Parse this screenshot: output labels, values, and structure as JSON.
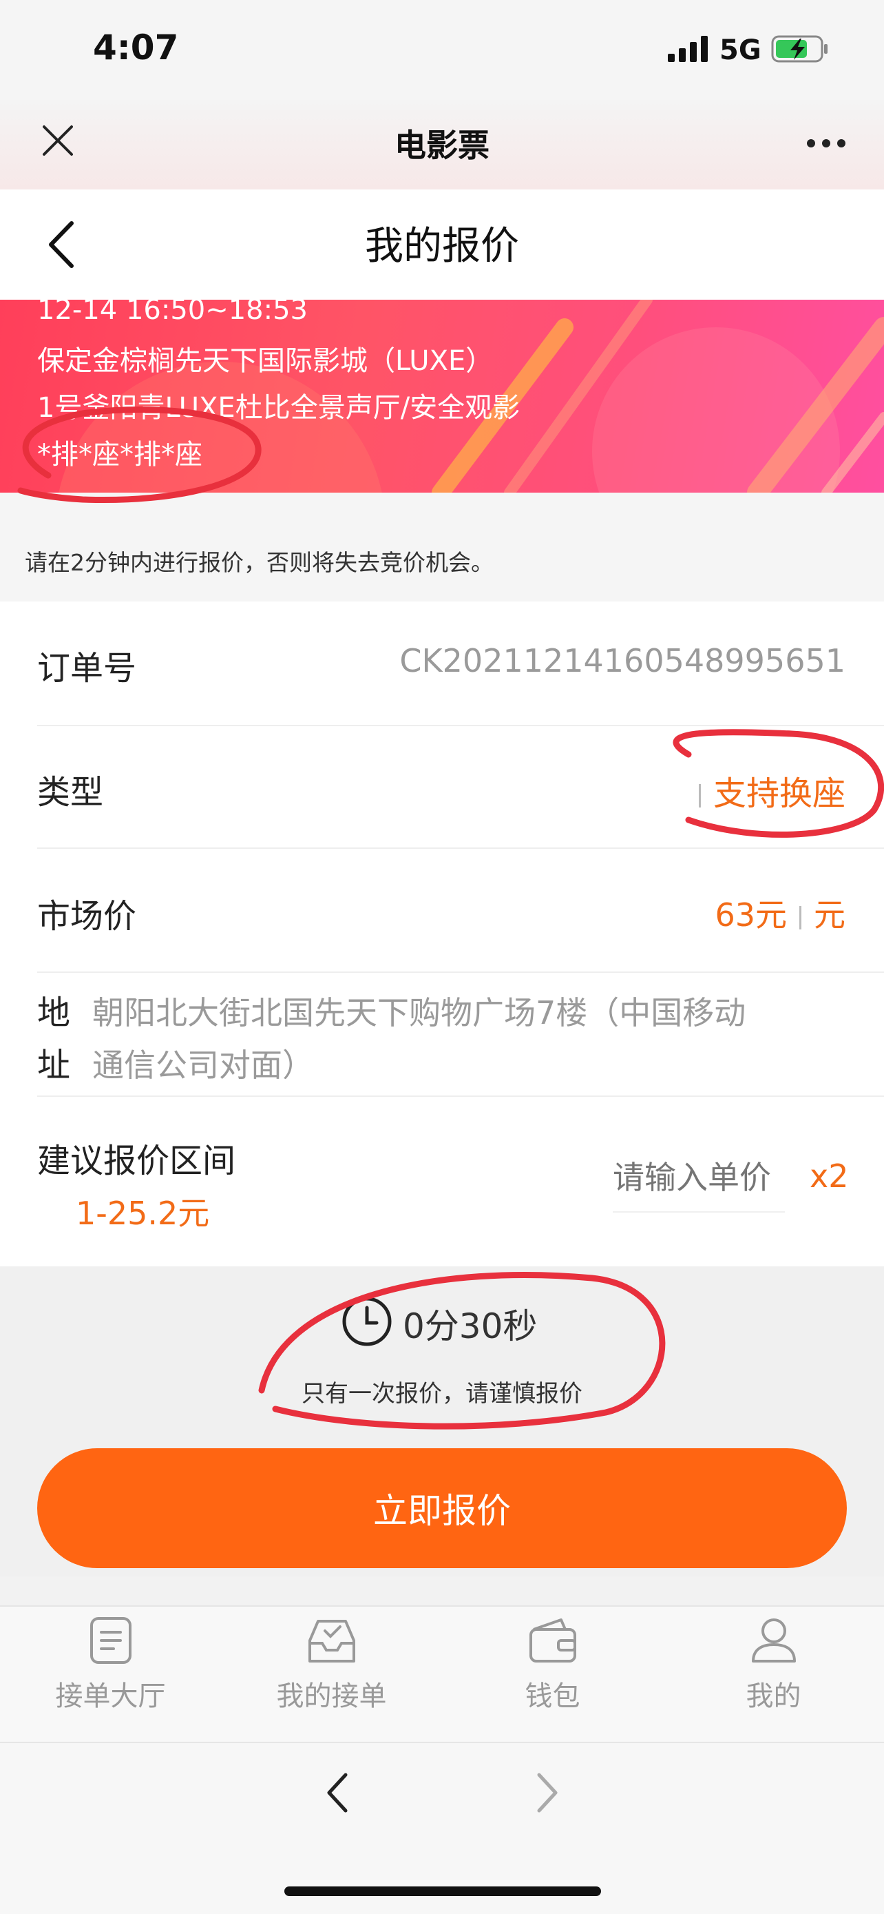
{
  "status_bar": {
    "time": "4:07",
    "network": "5G"
  },
  "wechat_bar": {
    "title": "电影票"
  },
  "header": {
    "title": "我的报价"
  },
  "banner": {
    "showtime": "12-14 16:50~18:53",
    "cinema": "保定金棕榈先天下国际影城（LUXE）",
    "hall": "1号釜阳青LUXE杜比全景声厅/安全观影",
    "seats": "*排*座*排*座"
  },
  "notice": "请在2分钟内进行报价，否则将失去竞价机会。",
  "form": {
    "order_label": "订单号",
    "order_value": "CK2021121416054899565​1",
    "type_label": "类型",
    "type_value": "支持换座",
    "market_label": "市场价",
    "market_value": "63元",
    "market_unit": "元",
    "address_label_1": "地",
    "address_label_2": "址",
    "address_line_1": "朝阳北大街北国先天下购物广场7楼（中国移动",
    "address_line_2": "通信公司对面）",
    "suggest_label": "建议报价区间",
    "suggest_range": "1-25.2元",
    "price_placeholder": "请输入单价",
    "quantity": "x2"
  },
  "timer": {
    "countdown": "0分30秒",
    "note": "只有一次报价，请谨慎报价"
  },
  "submit_label": "立即报价",
  "tabs": [
    {
      "label": "接单大厅",
      "icon": "list-icon"
    },
    {
      "label": "我的接单",
      "icon": "inbox-check-icon"
    },
    {
      "label": "钱包",
      "icon": "wallet-icon"
    },
    {
      "label": "我的",
      "icon": "user-icon"
    }
  ],
  "colors": {
    "accent": "#ff6512",
    "orange_text": "#f26b17",
    "annotation": "#e8303d"
  }
}
